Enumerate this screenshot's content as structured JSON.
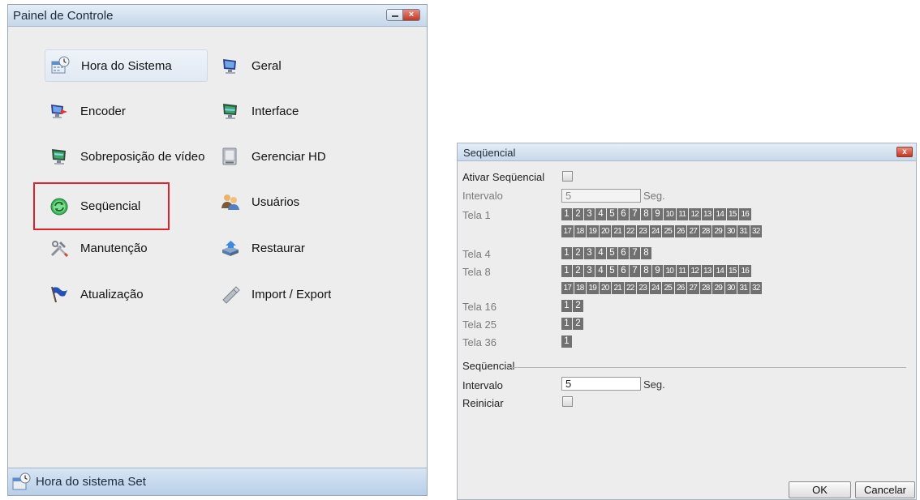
{
  "control_panel": {
    "title": "Painel de Controle",
    "items": [
      {
        "label": "Hora do Sistema",
        "icon": "calendar-clock-icon"
      },
      {
        "label": "Geral",
        "icon": "monitor-icon"
      },
      {
        "label": "Encoder",
        "icon": "monitor-arrow-icon"
      },
      {
        "label": "Interface",
        "icon": "display-icon"
      },
      {
        "label": "Sobreposição de vídeo",
        "icon": "overlay-monitor-icon"
      },
      {
        "label": "Gerenciar HD",
        "icon": "hard-drive-icon"
      },
      {
        "label": "Seqüencial",
        "icon": "cycle-icon"
      },
      {
        "label": "Usuários",
        "icon": "users-icon"
      },
      {
        "label": "Manutenção",
        "icon": "tools-icon"
      },
      {
        "label": "Restaurar",
        "icon": "restore-icon"
      },
      {
        "label": "Atualização",
        "icon": "flag-icon"
      },
      {
        "label": "Import / Export",
        "icon": "usb-stick-icon"
      }
    ],
    "status_text": "Hora do sistema Set"
  },
  "sequential_dialog": {
    "title": "Seqüencial",
    "close_glyph": "x",
    "enable_label": "Ativar Seqüencial",
    "interval_label": "Intervalo",
    "interval_value": "5",
    "unit": "Seg.",
    "screens": [
      {
        "label": "Tela 1",
        "rows": [
          [
            "1",
            "2",
            "3",
            "4",
            "5",
            "6",
            "7",
            "8",
            "9",
            "10",
            "11",
            "12",
            "13",
            "14",
            "15",
            "16"
          ],
          [
            "17",
            "18",
            "19",
            "20",
            "21",
            "22",
            "23",
            "24",
            "25",
            "26",
            "27",
            "28",
            "29",
            "30",
            "31",
            "32"
          ]
        ]
      },
      {
        "label": "Tela 4",
        "rows": [
          [
            "1",
            "2",
            "3",
            "4",
            "5",
            "6",
            "7",
            "8"
          ]
        ]
      },
      {
        "label": "Tela 8",
        "rows": [
          [
            "1",
            "2",
            "3",
            "4",
            "5",
            "6",
            "7",
            "8",
            "9",
            "10",
            "11",
            "12",
            "13",
            "14",
            "15",
            "16"
          ],
          [
            "17",
            "18",
            "19",
            "20",
            "21",
            "22",
            "23",
            "24",
            "25",
            "26",
            "27",
            "28",
            "29",
            "30",
            "31",
            "32"
          ]
        ]
      },
      {
        "label": "Tela 16",
        "rows": [
          [
            "1",
            "2"
          ]
        ]
      },
      {
        "label": "Tela 25",
        "rows": [
          [
            "1",
            "2"
          ]
        ]
      },
      {
        "label": "Tela 36",
        "rows": [
          [
            "1"
          ]
        ]
      }
    ],
    "section_label": "Seqüencial",
    "section_interval_label": "Intervalo",
    "section_interval_value": "5",
    "section_unit": "Seg.",
    "restart_label": "Reiniciar",
    "ok_label": "OK",
    "cancel_label": "Cancelar"
  }
}
